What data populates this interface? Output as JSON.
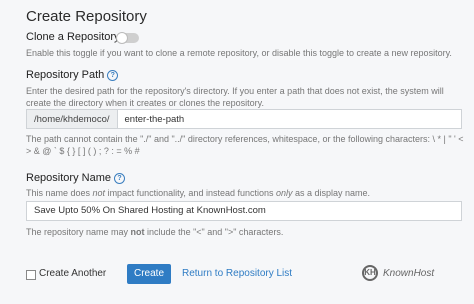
{
  "title": "Create Repository",
  "clone": {
    "label": "Clone a Repository",
    "help": "Enable this toggle if you want to clone a remote repository, or disable this toggle to create a new repository."
  },
  "path": {
    "label": "Repository Path",
    "help": "Enter the desired path for the repository's directory. If you enter a path that does not exist, the system will create the directory when it creates or clones the repository.",
    "prefix": "/home/khdemoco/",
    "value": "enter-the-path",
    "note": "The path cannot contain the \"./\" and \"../\" directory references, whitespace, or the following characters: \\ * | \" ' < > & @ ` $ { } [ ] ( ) ; ? : = % #"
  },
  "name": {
    "label": "Repository Name",
    "help_pre": "This name does ",
    "help_em1": "not",
    "help_mid": " impact functionality, and instead functions ",
    "help_em2": "only",
    "help_post": " as a display name.",
    "value": "Save Upto 50% On Shared Hosting at KnownHost.com",
    "note_pre": "The repository name may ",
    "note_bold": "not",
    "note_post": " include the \"<\" and \">\" characters."
  },
  "footer": {
    "create_another": "Create Another",
    "create_button": "Create",
    "return_link": "Return to Repository List"
  },
  "logo": {
    "mark": "KH",
    "text": "KnownHost"
  },
  "info_glyph": "?"
}
